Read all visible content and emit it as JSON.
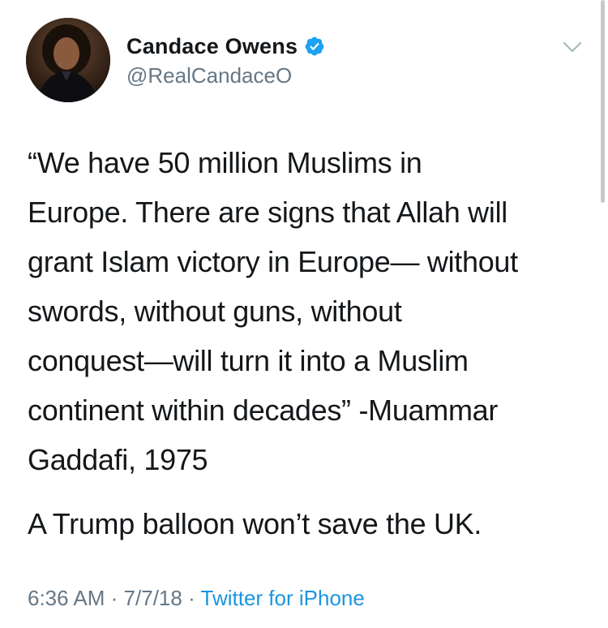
{
  "tweet": {
    "author": {
      "display_name": "Candace Owens",
      "handle": "@RealCandaceO",
      "verified": true
    },
    "text_lines": [
      "“We have 50 million Muslims in",
      "Europe. There are signs that Allah will",
      "grant Islam victory in Europe— without",
      "swords, without guns, without",
      "conquest—will turn it into a Muslim",
      "continent within decades” -Muammar",
      "Gaddafi, 1975"
    ],
    "text_second": "A Trump balloon won’t save the UK.",
    "time": "6:36 AM",
    "date": "7/7/18",
    "separator": "·",
    "source": "Twitter for iPhone"
  },
  "colors": {
    "text": "#14171a",
    "secondary": "#657786",
    "link": "#1b95e0",
    "verified": "#1da1f2"
  },
  "icons": {
    "verified": "verified-badge-icon",
    "menu": "chevron-down-icon"
  }
}
